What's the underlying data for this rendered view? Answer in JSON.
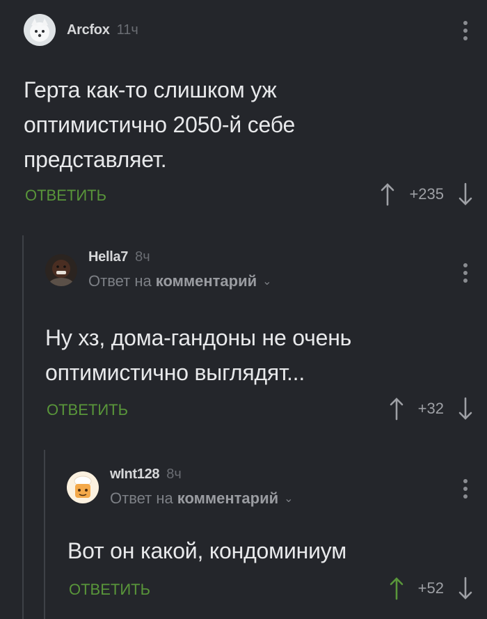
{
  "comments": [
    {
      "author": "Arcfox",
      "time": "11ч",
      "text_lines": [
        "Герта как-то слишком уж",
        "оптимистично 2050-й себе",
        "представляет."
      ],
      "reply_label": "ОТВЕТИТЬ",
      "rating": "+235",
      "upvoted": false,
      "avatar": "white-fox-avatar"
    },
    {
      "author": "Hella7",
      "time": "8ч",
      "reply_to_prefix": "Ответ на",
      "reply_to_target": "комментарий",
      "text_lines": [
        "Ну хз, дома-гандоны не очень",
        "оптимистично выглядят..."
      ],
      "reply_label": "ОТВЕТИТЬ",
      "rating": "+32",
      "upvoted": false,
      "avatar": "person-avatar"
    },
    {
      "author": "wInt128",
      "time": "8ч",
      "reply_to_prefix": "Ответ на",
      "reply_to_target": "комментарий",
      "text_lines": [
        "Вот он какой, кондоминиум"
      ],
      "reply_label": "ОТВЕТИТЬ",
      "rating": "+52",
      "upvoted": true,
      "avatar": "chef-cartoon-avatar"
    }
  ],
  "colors": {
    "background": "#24262b",
    "accent_green": "#59963a",
    "thread_line": "#3e4147"
  }
}
